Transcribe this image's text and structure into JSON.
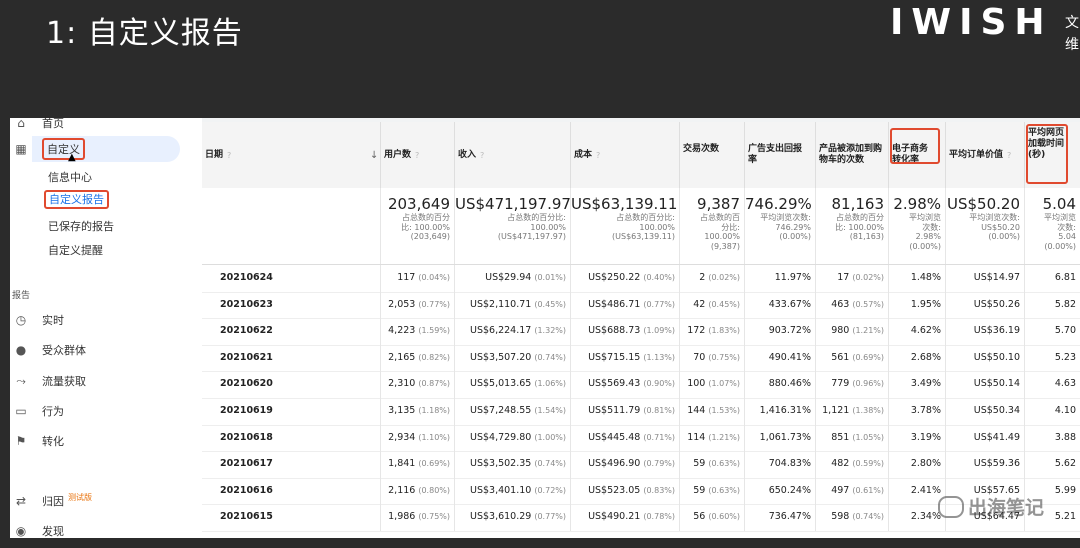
{
  "slide": {
    "title": "1: 自定义报告",
    "logo": "IWISH",
    "logo_cut_1": "文",
    "logo_cut_2": "维"
  },
  "sidebar": {
    "home_label": "首页",
    "customization_label": "自定义",
    "sub_items": [
      "信息中心",
      "自定义报告",
      "已保存的报告",
      "自定义提醒"
    ],
    "reports_section": "报告",
    "report_items": [
      {
        "label": "实时",
        "icon": "clock-icon"
      },
      {
        "label": "受众群体",
        "icon": "person-icon"
      },
      {
        "label": "流量获取",
        "icon": "acquisition-icon"
      },
      {
        "label": "行为",
        "icon": "behavior-icon"
      },
      {
        "label": "转化",
        "icon": "flag-icon"
      }
    ],
    "attribution_label": "归因",
    "attribution_badge": "测试版",
    "discover_label": "发现"
  },
  "table": {
    "headers": {
      "date": "日期",
      "users": "用户数",
      "revenue": "收入",
      "cost": "成本",
      "transactions": "交易次数",
      "roas": "广告支出回报率",
      "add_to_cart": "产品被添加到购物车的次数",
      "ecommerce_rate": "电子商务转化率",
      "avg_order_value": "平均订单价值",
      "avg_page_load": "平均网页加载时间(秒)"
    },
    "totals": {
      "users": {
        "big": "203,649",
        "l1": "占总数的百分",
        "l2": "比: 100.00%",
        "l3": "(203,649)"
      },
      "revenue": {
        "big": "US$471,197.97",
        "l1": "占总数的百分比:",
        "l2": "100.00%",
        "l3": "(US$471,197.97)"
      },
      "cost": {
        "big": "US$63,139.11",
        "l1": "占总数的百分比:",
        "l2": "100.00%",
        "l3": "(US$63,139.11)"
      },
      "transactions": {
        "big": "9,387",
        "l1": "占总数的百",
        "l2": "分比:",
        "l3": "100.00%",
        "l4": "(9,387)"
      },
      "roas": {
        "big": "746.29%",
        "l1": "平均浏览次数:",
        "l2": "746.29%",
        "l3": "(0.00%)"
      },
      "add_to_cart": {
        "big": "81,163",
        "l1": "占总数的百分",
        "l2": "比: 100.00%",
        "l3": "(81,163)"
      },
      "ecommerce_rate": {
        "big": "2.98%",
        "l1": "平均浏览",
        "l2": "次数:",
        "l3": "2.98%",
        "l4": "(0.00%)"
      },
      "avg_order_value": {
        "big": "US$50.20",
        "l1": "平均浏览次数:",
        "l2": "US$50.20",
        "l3": "(0.00%)"
      },
      "avg_page_load": {
        "big": "5.04",
        "l1": "平均浏览",
        "l2": "次数:",
        "l3": "5.04",
        "l4": "(0.00%)"
      }
    },
    "rows": [
      {
        "date": "20210624",
        "users": "117",
        "users_pct": "(0.04%)",
        "revenue": "US$29.94",
        "revenue_pct": "(0.01%)",
        "cost": "US$250.22",
        "cost_pct": "(0.40%)",
        "tx": "2",
        "tx_pct": "(0.02%)",
        "roas": "11.97%",
        "cart": "17",
        "cart_pct": "(0.02%)",
        "rate": "1.48%",
        "aov": "US$14.97",
        "load": "6.81"
      },
      {
        "date": "20210623",
        "users": "2,053",
        "users_pct": "(0.77%)",
        "revenue": "US$2,110.71",
        "revenue_pct": "(0.45%)",
        "cost": "US$486.71",
        "cost_pct": "(0.77%)",
        "tx": "42",
        "tx_pct": "(0.45%)",
        "roas": "433.67%",
        "cart": "463",
        "cart_pct": "(0.57%)",
        "rate": "1.95%",
        "aov": "US$50.26",
        "load": "5.82"
      },
      {
        "date": "20210622",
        "users": "4,223",
        "users_pct": "(1.59%)",
        "revenue": "US$6,224.17",
        "revenue_pct": "(1.32%)",
        "cost": "US$688.73",
        "cost_pct": "(1.09%)",
        "tx": "172",
        "tx_pct": "(1.83%)",
        "roas": "903.72%",
        "cart": "980",
        "cart_pct": "(1.21%)",
        "rate": "4.62%",
        "aov": "US$36.19",
        "load": "5.70"
      },
      {
        "date": "20210621",
        "users": "2,165",
        "users_pct": "(0.82%)",
        "revenue": "US$3,507.20",
        "revenue_pct": "(0.74%)",
        "cost": "US$715.15",
        "cost_pct": "(1.13%)",
        "tx": "70",
        "tx_pct": "(0.75%)",
        "roas": "490.41%",
        "cart": "561",
        "cart_pct": "(0.69%)",
        "rate": "2.68%",
        "aov": "US$50.10",
        "load": "5.23"
      },
      {
        "date": "20210620",
        "users": "2,310",
        "users_pct": "(0.87%)",
        "revenue": "US$5,013.65",
        "revenue_pct": "(1.06%)",
        "cost": "US$569.43",
        "cost_pct": "(0.90%)",
        "tx": "100",
        "tx_pct": "(1.07%)",
        "roas": "880.46%",
        "cart": "779",
        "cart_pct": "(0.96%)",
        "rate": "3.49%",
        "aov": "US$50.14",
        "load": "4.63"
      },
      {
        "date": "20210619",
        "users": "3,135",
        "users_pct": "(1.18%)",
        "revenue": "US$7,248.55",
        "revenue_pct": "(1.54%)",
        "cost": "US$511.79",
        "cost_pct": "(0.81%)",
        "tx": "144",
        "tx_pct": "(1.53%)",
        "roas": "1,416.31%",
        "cart": "1,121",
        "cart_pct": "(1.38%)",
        "rate": "3.78%",
        "aov": "US$50.34",
        "load": "4.10"
      },
      {
        "date": "20210618",
        "users": "2,934",
        "users_pct": "(1.10%)",
        "revenue": "US$4,729.80",
        "revenue_pct": "(1.00%)",
        "cost": "US$445.48",
        "cost_pct": "(0.71%)",
        "tx": "114",
        "tx_pct": "(1.21%)",
        "roas": "1,061.73%",
        "cart": "851",
        "cart_pct": "(1.05%)",
        "rate": "3.19%",
        "aov": "US$41.49",
        "load": "3.88"
      },
      {
        "date": "20210617",
        "users": "1,841",
        "users_pct": "(0.69%)",
        "revenue": "US$3,502.35",
        "revenue_pct": "(0.74%)",
        "cost": "US$496.90",
        "cost_pct": "(0.79%)",
        "tx": "59",
        "tx_pct": "(0.63%)",
        "roas": "704.83%",
        "cart": "482",
        "cart_pct": "(0.59%)",
        "rate": "2.80%",
        "aov": "US$59.36",
        "load": "5.62"
      },
      {
        "date": "20210616",
        "users": "2,116",
        "users_pct": "(0.80%)",
        "revenue": "US$3,401.10",
        "revenue_pct": "(0.72%)",
        "cost": "US$523.05",
        "cost_pct": "(0.83%)",
        "tx": "59",
        "tx_pct": "(0.63%)",
        "roas": "650.24%",
        "cart": "497",
        "cart_pct": "(0.61%)",
        "rate": "2.41%",
        "aov": "US$57.65",
        "load": "5.99"
      },
      {
        "date": "20210615",
        "users": "1,986",
        "users_pct": "(0.75%)",
        "revenue": "US$3,610.29",
        "revenue_pct": "(0.77%)",
        "cost": "US$490.21",
        "cost_pct": "(0.78%)",
        "tx": "56",
        "tx_pct": "(0.60%)",
        "roas": "736.47%",
        "cart": "598",
        "cart_pct": "(0.74%)",
        "rate": "2.34%",
        "aov": "US$64.47",
        "load": "5.21"
      }
    ]
  },
  "watermark": "出海笔记",
  "colors": {
    "highlight": "#e04a2f",
    "active_bg": "#e8f0fe",
    "beta": "#e8710a"
  }
}
